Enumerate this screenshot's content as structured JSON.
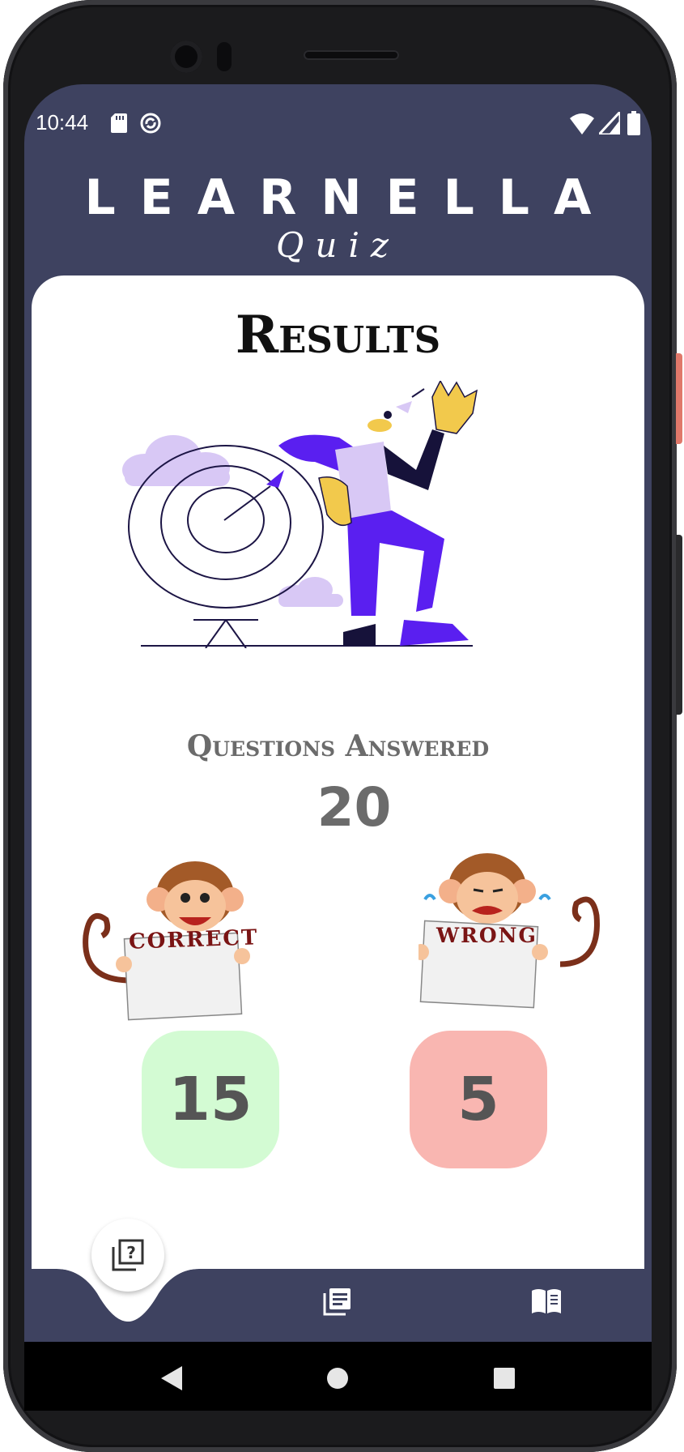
{
  "status_bar": {
    "time": "10:44",
    "icons": [
      "sd-card-icon",
      "sync-icon",
      "wifi-icon",
      "signal-icon",
      "battery-icon"
    ]
  },
  "brand": {
    "title": "LEARNELLA",
    "subtitle": "Quiz"
  },
  "results": {
    "title": "Results",
    "questions_label": "Questions Answered",
    "questions_value": "20",
    "correct_sign": "CORRECT",
    "correct_value": "15",
    "wrong_sign": "WRONG",
    "wrong_value": "5"
  },
  "bottom_nav": {
    "items": [
      "quiz-icon",
      "articles-icon",
      "book-icon"
    ],
    "active": "quiz-icon"
  },
  "system_nav": [
    "back-icon",
    "home-icon",
    "recent-apps-icon"
  ],
  "colors": {
    "header": "#3e4260",
    "correct_box": "#d3fbd3",
    "wrong_box": "#f9b6b1",
    "accent_purple": "#5a1ff0"
  }
}
